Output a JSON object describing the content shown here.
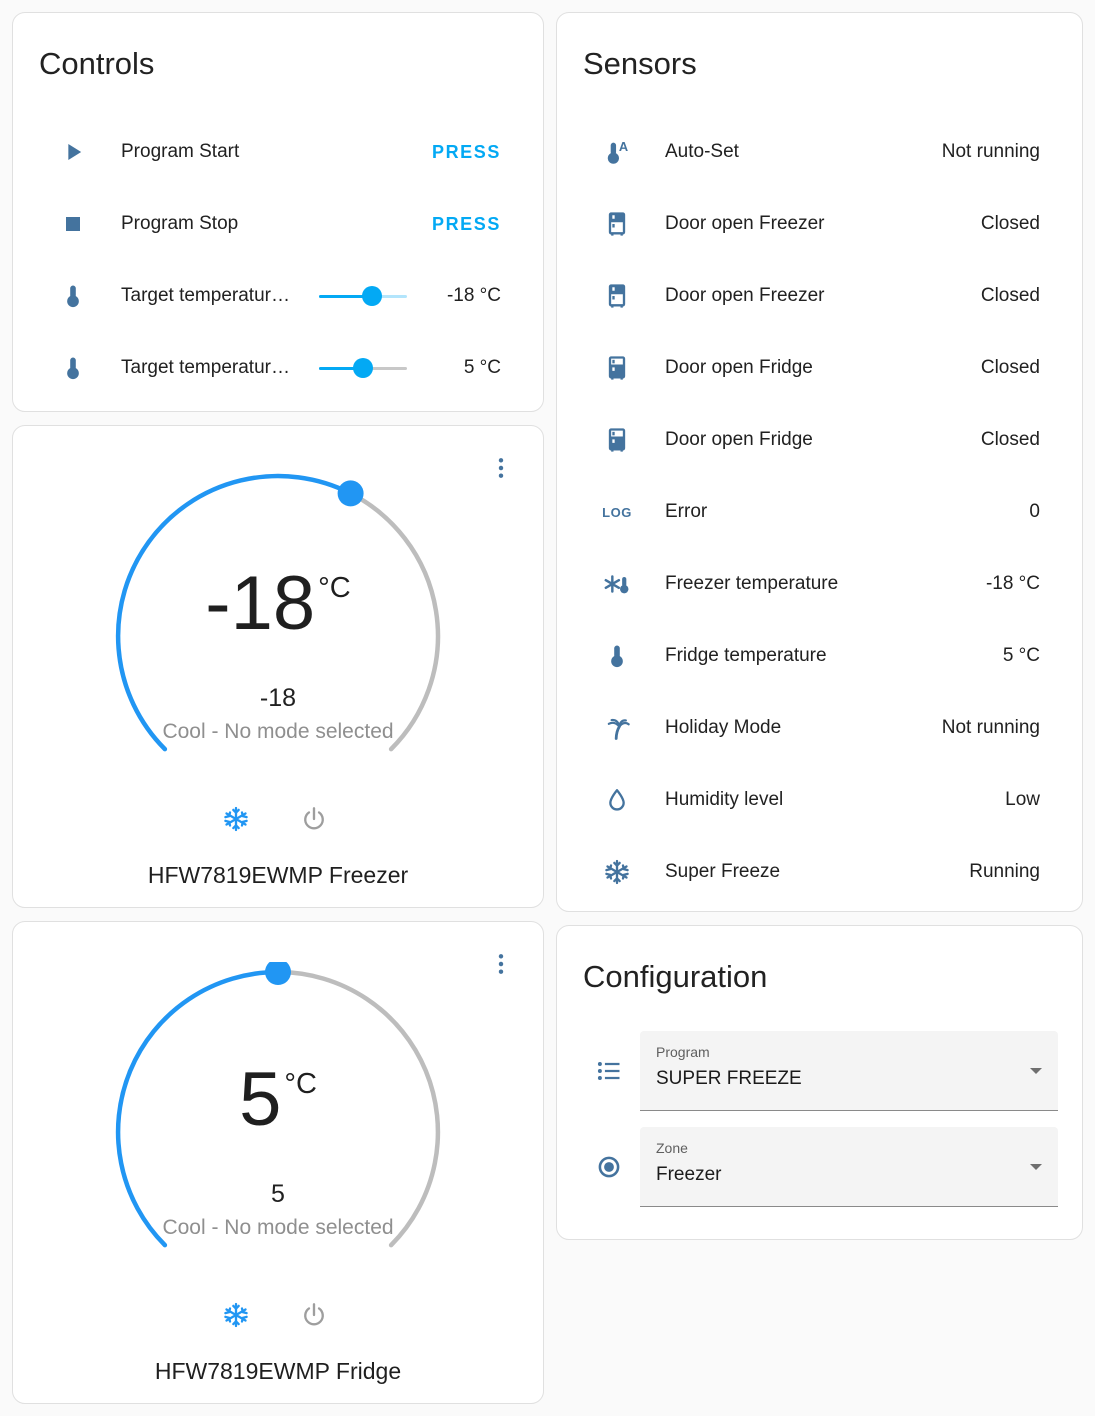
{
  "colors": {
    "accent": "#03a9f4",
    "icon_color": "#44739e",
    "dial_active": "#2196f3",
    "dial_inactive": "#bdbdbd"
  },
  "controls": {
    "title": "Controls",
    "rows": [
      {
        "icon": "play-icon",
        "label": "Program Start",
        "action": "PRESS"
      },
      {
        "icon": "stop-icon",
        "label": "Program Stop",
        "action": "PRESS"
      },
      {
        "icon": "thermometer-icon",
        "label": "Target temperatur…",
        "value": "-18 °C",
        "fraction": 0.6,
        "inactive_color": "#b3e5fc"
      },
      {
        "icon": "thermometer-icon",
        "label": "Target temperatur…",
        "value": "5 °C",
        "fraction": 0.5,
        "inactive_color": "#c8c8c8"
      }
    ]
  },
  "thermostats": [
    {
      "temp": "-18",
      "unit": "°C",
      "target": "-18",
      "mode_text": "Cool - No mode selected",
      "name": "HFW7819EWMP Freezer",
      "dial_fraction": 0.6,
      "menu_icon": "dots-vertical-icon",
      "modes": [
        {
          "icon": "snowflake-icon",
          "state": "active"
        },
        {
          "icon": "power-icon",
          "state": "inactive"
        }
      ]
    },
    {
      "temp": "5",
      "unit": "°C",
      "target": "5",
      "mode_text": "Cool - No mode selected",
      "name": "HFW7819EWMP Fridge",
      "dial_fraction": 0.5,
      "menu_icon": "dots-vertical-icon",
      "modes": [
        {
          "icon": "snowflake-icon",
          "state": "active"
        },
        {
          "icon": "power-icon",
          "state": "inactive"
        }
      ]
    }
  ],
  "sensors": {
    "title": "Sensors",
    "rows": [
      {
        "icon": "thermometer-auto-icon",
        "label": "Auto-Set",
        "value": "Not running"
      },
      {
        "icon": "fridge-top-icon",
        "label": "Door open Freezer",
        "value": "Closed"
      },
      {
        "icon": "fridge-top-icon",
        "label": "Door open Freezer",
        "value": "Closed"
      },
      {
        "icon": "fridge-bottom-icon",
        "label": "Door open Fridge",
        "value": "Closed"
      },
      {
        "icon": "fridge-bottom-icon",
        "label": "Door open Fridge",
        "value": "Closed"
      },
      {
        "icon": "log-icon",
        "label": "Error",
        "value": "0"
      },
      {
        "icon": "snowflake-thermometer-icon",
        "label": "Freezer temperature",
        "value": "-18 °C"
      },
      {
        "icon": "thermometer-icon",
        "label": "Fridge temperature",
        "value": "5 °C"
      },
      {
        "icon": "palm-tree-icon",
        "label": "Holiday Mode",
        "value": "Not running"
      },
      {
        "icon": "water-drop-icon",
        "label": "Humidity level",
        "value": "Low"
      },
      {
        "icon": "snowflake-icon",
        "label": "Super Freeze",
        "value": "Running"
      }
    ]
  },
  "configuration": {
    "title": "Configuration",
    "fields": [
      {
        "icon": "format-list-icon",
        "label": "Program",
        "value": "SUPER FREEZE"
      },
      {
        "icon": "radiobox-marked-icon",
        "label": "Zone",
        "value": "Freezer"
      }
    ]
  }
}
